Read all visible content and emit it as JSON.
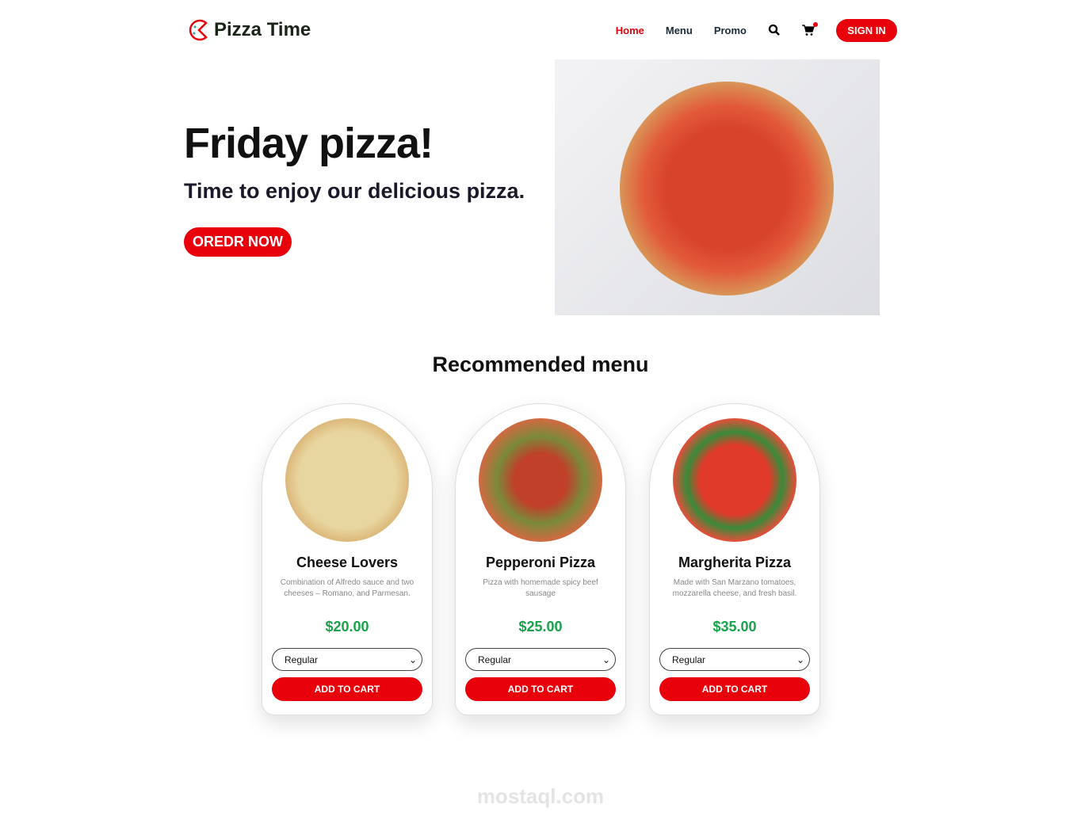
{
  "brand": {
    "name": "Pizza Time"
  },
  "nav": {
    "items": [
      {
        "label": "Home",
        "active": true
      },
      {
        "label": "Menu"
      },
      {
        "label": "Promo"
      }
    ],
    "search_icon": "search-icon",
    "cart_icon": "cart-icon",
    "sign_in": "SIGN IN"
  },
  "hero": {
    "title": "Friday pizza!",
    "subtitle": "Time to enjoy our delicious pizza.",
    "cta": "OREDR NOW"
  },
  "menu": {
    "title": "Recommended menu",
    "items": [
      {
        "name": "Cheese Lovers",
        "description": "Combination of Alfredo sauce and two cheeses – Romano, and Parmesan.",
        "price": "$20.00",
        "size": "Regular",
        "button": "ADD TO CART"
      },
      {
        "name": "Pepperoni Pizza",
        "description": "Pizza with homemade spicy beef sausage",
        "price": "$25.00",
        "size": "Regular",
        "button": "ADD TO CART"
      },
      {
        "name": "Margherita Pizza",
        "description": "Made with San Marzano tomatoes, mozzarella cheese, and fresh basil.",
        "price": "$35.00",
        "size": "Regular",
        "button": "ADD TO CART"
      }
    ]
  },
  "watermark": "mostaql.com",
  "colors": {
    "accent": "#e8000b",
    "price": "#16a34a"
  }
}
